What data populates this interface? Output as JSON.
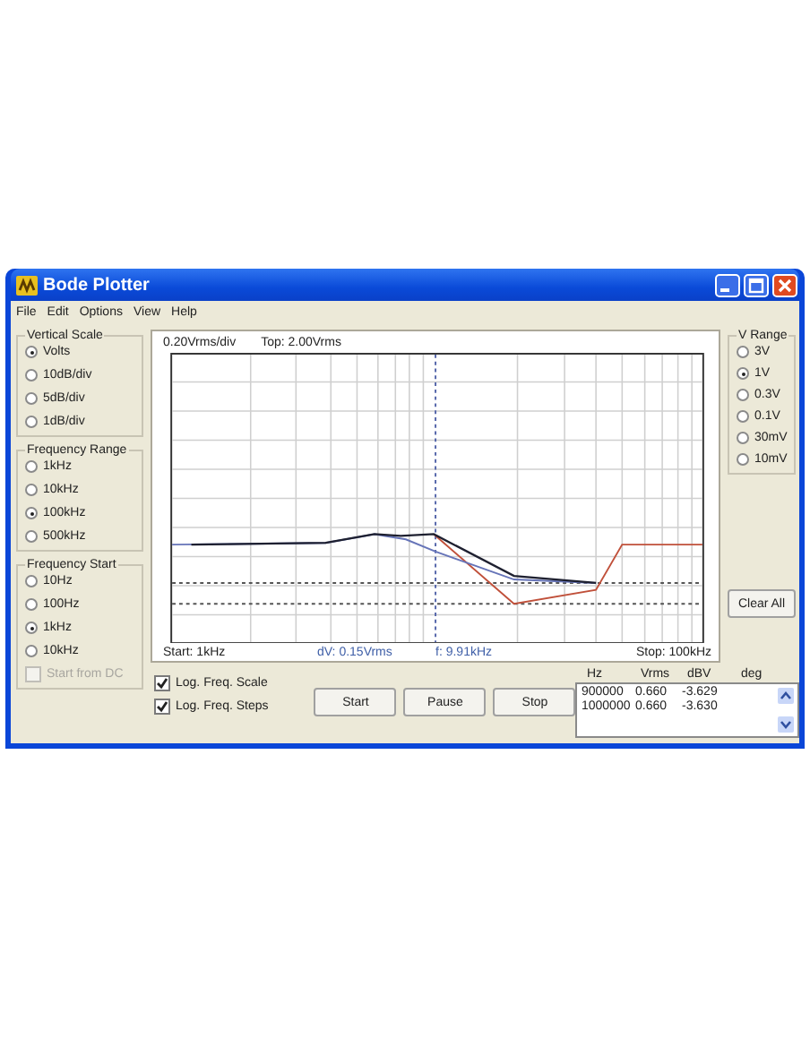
{
  "window": {
    "title": "Bode Plotter"
  },
  "menu": [
    "File",
    "Edit",
    "Options",
    "View",
    "Help"
  ],
  "groups": [
    {
      "title": "Vertical Scale",
      "options": [
        {
          "label": "Volts",
          "selected": true
        },
        {
          "label": "10dB/div",
          "selected": false
        },
        {
          "label": "5dB/div",
          "selected": false
        },
        {
          "label": "1dB/div",
          "selected": false
        }
      ]
    },
    {
      "title": "Frequency Range",
      "options": [
        {
          "label": "1kHz",
          "selected": false
        },
        {
          "label": "10kHz",
          "selected": false
        },
        {
          "label": "100kHz",
          "selected": true
        },
        {
          "label": "500kHz",
          "selected": false
        }
      ]
    },
    {
      "title": "Frequency Start",
      "options": [
        {
          "label": "10Hz",
          "selected": false
        },
        {
          "label": "100Hz",
          "selected": false
        },
        {
          "label": "1kHz",
          "selected": true
        },
        {
          "label": "10kHz",
          "selected": false
        }
      ],
      "checkbox": {
        "label": "Start from DC",
        "checked": false,
        "disabled": true
      }
    }
  ],
  "v_range": {
    "title": "V Range",
    "options": [
      {
        "label": "3V",
        "selected": false
      },
      {
        "label": "1V",
        "selected": true
      },
      {
        "label": "0.3V",
        "selected": false
      },
      {
        "label": "0.1V",
        "selected": false
      },
      {
        "label": "30mV",
        "selected": false
      },
      {
        "label": "10mV",
        "selected": false
      }
    ]
  },
  "chart": {
    "scale": "0.20Vrms/div",
    "top": "Top: 2.00Vrms",
    "start": "Start: 1kHz",
    "dv": "dV: 0.15Vrms",
    "f": "f: 9.91kHz",
    "stop": "Stop: 100kHz"
  },
  "checkboxes": [
    {
      "label": "Log. Freq. Scale",
      "checked": true
    },
    {
      "label": "Log. Freq. Steps",
      "checked": true
    }
  ],
  "buttons": [
    "Start",
    "Pause",
    "Stop"
  ],
  "clear_button": "Clear All",
  "table": {
    "columns": [
      "Hz",
      "Vrms",
      "dBV",
      "deg"
    ],
    "rows": [
      [
        "900000",
        "0.660",
        "-3.629"
      ],
      [
        "1000000",
        "0.660",
        "-3.630"
      ]
    ]
  }
}
